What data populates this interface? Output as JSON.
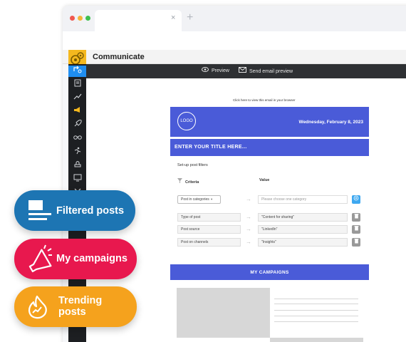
{
  "browser": {
    "tab_close": "×",
    "tab_new": "+"
  },
  "app": {
    "title": "Communicate"
  },
  "toolbar": {
    "preview_label": "Preview",
    "send_preview_label": "Send email preview"
  },
  "sidebar": {
    "items": [
      {
        "icon": "user-switch-icon"
      },
      {
        "icon": "document-icon"
      },
      {
        "icon": "trend-icon"
      },
      {
        "icon": "megaphone-icon"
      },
      {
        "icon": "rocket-icon"
      },
      {
        "icon": "binoculars-icon"
      },
      {
        "icon": "runner-icon"
      },
      {
        "icon": "stamp-icon"
      },
      {
        "icon": "screen-icon"
      },
      {
        "icon": "tools-icon"
      }
    ]
  },
  "email": {
    "view_in_browser": "Click here to view this email in your browser",
    "logo_text": "LOGO",
    "date": "Wednesday, February 8, 2023",
    "title_placeholder": "ENTER YOUR TITLE HERE...",
    "setup_label": "Set-up post filters",
    "criteria_header": "Criteria",
    "value_header": "Value",
    "filters": [
      {
        "criteria": "Post in categories",
        "value": "Please choose one category",
        "button": "add"
      },
      {
        "criteria": "Type of post",
        "value": "\"Content for sharing\"",
        "button": "delete"
      },
      {
        "criteria": "Post source",
        "value": "\"LinkedIn\"",
        "button": "delete"
      },
      {
        "criteria": "Post on channels",
        "value": "\"Insights\"",
        "button": "delete"
      }
    ],
    "campaigns_heading": "MY CAMPAIGNS"
  },
  "pills": [
    {
      "label": "Filtered posts",
      "color": "#1d75b3",
      "icon": "posts-icon"
    },
    {
      "label": "My campaigns",
      "color": "#e8184e",
      "icon": "megaphone-icon"
    },
    {
      "label_line1": "Trending",
      "label_line2": "posts",
      "color": "#f5a21d",
      "icon": "flame-icon"
    }
  ],
  "colors": {
    "accent": "#4a5bd8",
    "sidebar_active": "#1f8ef1",
    "brand_logo": "#f4b81e"
  }
}
